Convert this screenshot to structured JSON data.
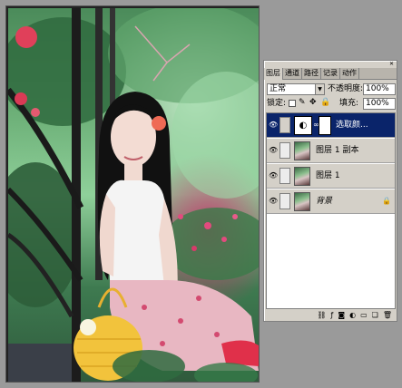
{
  "layers_panel": {
    "tabs": [
      "图层",
      "通道",
      "路径",
      "记录",
      "动作"
    ],
    "blend_mode": "正常",
    "opacity_label": "不透明度:",
    "opacity_value": "100%",
    "lock_label": "锁定:",
    "fill_label": "填充:",
    "fill_value": "100%",
    "layers": [
      {
        "name": "选取颜...",
        "type": "adjustment",
        "selected": true,
        "visible": true
      },
      {
        "name": "图层 1 副本",
        "type": "pixel",
        "selected": false,
        "visible": true
      },
      {
        "name": "图层 1",
        "type": "pixel",
        "selected": false,
        "visible": true
      },
      {
        "name": "背景",
        "type": "background",
        "selected": false,
        "visible": true,
        "locked": true
      }
    ],
    "bottom_icons": [
      "link-icon",
      "fx-icon",
      "mask-icon",
      "adjustment-icon",
      "folder-icon",
      "new-layer-icon",
      "trash-icon"
    ]
  },
  "colors": {
    "selection": "#0a246a",
    "panel_bg": "#d4d0c8"
  }
}
